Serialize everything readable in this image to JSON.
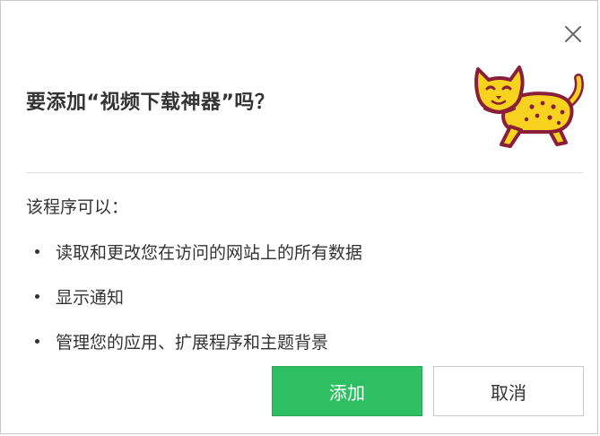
{
  "dialog": {
    "title": "要添加“视频下载神器”吗？",
    "close_icon": "close-icon",
    "mascot_icon": "cheetah-mascot-icon",
    "colors": {
      "primary_button": "#2fbf63",
      "divider": "#e3e3e3",
      "mascot_body": "#f7d21e",
      "mascot_outline": "#8a1f3a"
    }
  },
  "permissions": {
    "heading": "该程序可以：",
    "items": [
      "读取和更改您在访问的网站上的所有数据",
      "显示通知",
      "管理您的应用、扩展程序和主题背景"
    ]
  },
  "buttons": {
    "add_label": "添加",
    "cancel_label": "取消"
  }
}
